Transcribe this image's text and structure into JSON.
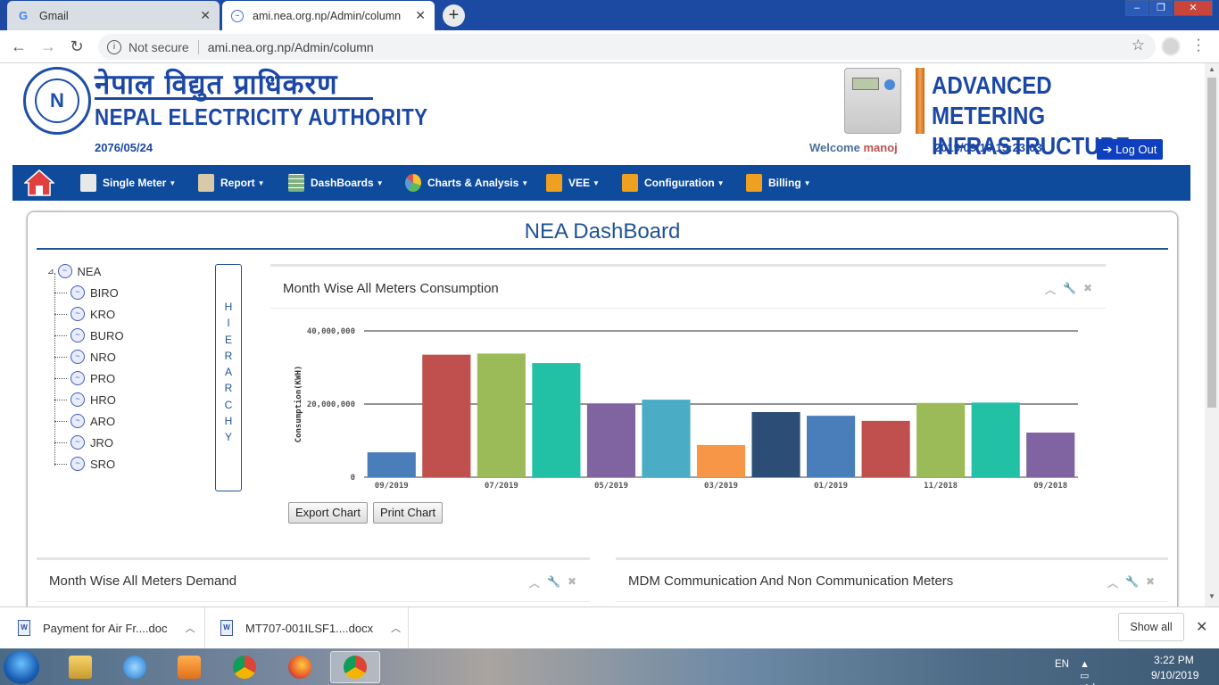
{
  "browser": {
    "tabs": [
      {
        "title": "Gmail",
        "icon": "gmail-icon"
      },
      {
        "title": "ami.nea.org.np/Admin/column",
        "icon": "site-icon"
      }
    ],
    "security_label": "Not secure",
    "url": "ami.nea.org.np/Admin/column"
  },
  "header": {
    "org_name_np": "नेपाल विद्युत प्राधिकरण",
    "org_name_en": "NEPAL ELECTRICITY AUTHORITY",
    "nepali_date": "2076/05/24",
    "ami_title_line1": "ADVANCED METERING",
    "ami_title_line2": "INFRASTRUCTURE (AMI)",
    "welcome_label": "Welcome",
    "username": "manoj",
    "datetime": "2019/09/10 15:23:03",
    "logout_label": "Log Out"
  },
  "nav": [
    {
      "label": "Single Meter",
      "icon": "meter-icon"
    },
    {
      "label": "Report",
      "icon": "report-icon"
    },
    {
      "label": "DashBoards",
      "icon": "table-icon"
    },
    {
      "label": "Charts & Analysis",
      "icon": "pie-chart-icon"
    },
    {
      "label": "VEE",
      "icon": "folder-gear-icon"
    },
    {
      "label": "Configuration",
      "icon": "folder-gear-icon"
    },
    {
      "label": "Billing",
      "icon": "folder-gear-icon"
    }
  ],
  "dashboard": {
    "title": "NEA DashBoard",
    "tree_root": "NEA",
    "tree_children": [
      "BIRO",
      "KRO",
      "BURO",
      "NRO",
      "PRO",
      "HRO",
      "ARO",
      "JRO",
      "SRO"
    ],
    "hierarchy_label": "H\nI\nE\nR\nA\nR\nC\nH\nY",
    "chart_panel_title": "Month Wise All Meters Consumption",
    "export_label": "Export Chart",
    "print_label": "Print Chart",
    "demand_panel_title": "Month Wise All Meters Demand",
    "mdm_panel_title": "MDM Communication And Non Communication Meters"
  },
  "chart_data": {
    "type": "bar",
    "categories": [
      "09/2019",
      "08/2019",
      "07/2019",
      "06/2019",
      "05/2019",
      "04/2019",
      "03/2019",
      "02/2019",
      "01/2019",
      "12/2018",
      "11/2018",
      "10/2018",
      "09/2018"
    ],
    "tick_labels": [
      "09/2019",
      "07/2019",
      "05/2019",
      "03/2019",
      "01/2019",
      "11/2018",
      "09/2018"
    ],
    "values": [
      6800000,
      33500000,
      33800000,
      31200000,
      20000000,
      21200000,
      8800000,
      17800000,
      16800000,
      15400000,
      20300000,
      20400000,
      12200000
    ],
    "colors": [
      "#4a7ebb",
      "#c0504d",
      "#9bbb59",
      "#22c1a6",
      "#8064a2",
      "#4bacc6",
      "#f79646",
      "#2c4d75",
      "#4a7ebb",
      "#c0504d",
      "#9bbb59",
      "#22c1a6",
      "#8064a2"
    ],
    "ylabel": "Consumption(KWH)",
    "ylim": [
      0,
      40000000
    ],
    "yticks": [
      0,
      20000000,
      40000000
    ],
    "ytick_labels": [
      "0",
      "20,000,000",
      "40,000,000"
    ],
    "grid": true
  },
  "downloads": {
    "items": [
      "Payment for Air Fr....doc",
      "MT707-001ILSF1....docx"
    ],
    "show_all_label": "Show all"
  },
  "taskbar": {
    "language": "EN",
    "time": "3:22 PM",
    "date": "9/10/2019"
  }
}
